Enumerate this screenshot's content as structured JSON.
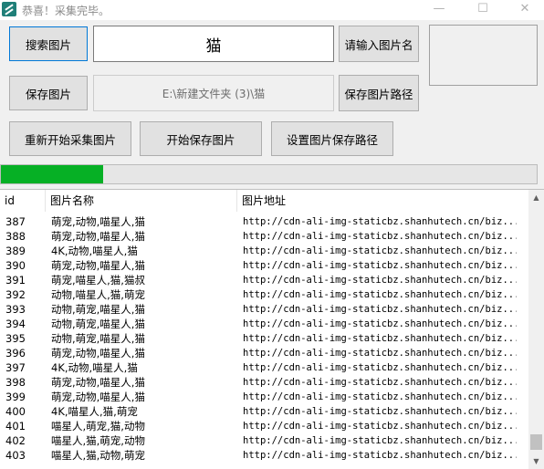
{
  "window": {
    "title": "恭喜！采集完毕。",
    "minimize": "—",
    "maximize": "☐",
    "close": "✕"
  },
  "search": {
    "button": "搜索图片",
    "keyword": "猫",
    "hint_button": "请输入图片名"
  },
  "save": {
    "button": "保存图片",
    "path": "E:\\新建文件夹 (3)\\猫",
    "path_button": "保存图片路径"
  },
  "actions": {
    "restart": "重新开始采集图片",
    "start_save": "开始保存图片",
    "set_path": "设置图片保存路径"
  },
  "progress": {
    "fraction": 0.19
  },
  "list": {
    "headers": {
      "id": "id",
      "name": "图片名称",
      "url": "图片地址"
    },
    "rows": [
      {
        "id": "387",
        "name": "萌宠,动物,喵星人,猫",
        "url": "http://cdn-ali-img-staticbz.shanhutech.cn/biz..."
      },
      {
        "id": "388",
        "name": "萌宠,动物,喵星人,猫",
        "url": "http://cdn-ali-img-staticbz.shanhutech.cn/biz..."
      },
      {
        "id": "389",
        "name": "4K,动物,喵星人,猫",
        "url": "http://cdn-ali-img-staticbz.shanhutech.cn/biz..."
      },
      {
        "id": "390",
        "name": "萌宠,动物,喵星人,猫",
        "url": "http://cdn-ali-img-staticbz.shanhutech.cn/biz..."
      },
      {
        "id": "391",
        "name": "萌宠,喵星人,猫,猫叔",
        "url": "http://cdn-ali-img-staticbz.shanhutech.cn/biz..."
      },
      {
        "id": "392",
        "name": "动物,喵星人,猫,萌宠",
        "url": "http://cdn-ali-img-staticbz.shanhutech.cn/biz..."
      },
      {
        "id": "393",
        "name": "动物,萌宠,喵星人,猫",
        "url": "http://cdn-ali-img-staticbz.shanhutech.cn/biz..."
      },
      {
        "id": "394",
        "name": "动物,萌宠,喵星人,猫",
        "url": "http://cdn-ali-img-staticbz.shanhutech.cn/biz..."
      },
      {
        "id": "395",
        "name": "动物,萌宠,喵星人,猫",
        "url": "http://cdn-ali-img-staticbz.shanhutech.cn/biz..."
      },
      {
        "id": "396",
        "name": "萌宠,动物,喵星人,猫",
        "url": "http://cdn-ali-img-staticbz.shanhutech.cn/biz..."
      },
      {
        "id": "397",
        "name": "4K,动物,喵星人,猫",
        "url": "http://cdn-ali-img-staticbz.shanhutech.cn/biz..."
      },
      {
        "id": "398",
        "name": "萌宠,动物,喵星人,猫",
        "url": "http://cdn-ali-img-staticbz.shanhutech.cn/biz..."
      },
      {
        "id": "399",
        "name": "萌宠,动物,喵星人,猫",
        "url": "http://cdn-ali-img-staticbz.shanhutech.cn/biz..."
      },
      {
        "id": "400",
        "name": "4K,喵星人,猫,萌宠",
        "url": "http://cdn-ali-img-staticbz.shanhutech.cn/biz..."
      },
      {
        "id": "401",
        "name": "喵星人,萌宠,猫,动物",
        "url": "http://cdn-ali-img-staticbz.shanhutech.cn/biz..."
      },
      {
        "id": "402",
        "name": "喵星人,猫,萌宠,动物",
        "url": "http://cdn-ali-img-staticbz.shanhutech.cn/biz..."
      },
      {
        "id": "403",
        "name": "喵星人,猫,动物,萌宠",
        "url": "http://cdn-ali-img-staticbz.shanhutech.cn/biz..."
      }
    ]
  },
  "scrollbar": {
    "up": "▲",
    "down": "▼"
  }
}
